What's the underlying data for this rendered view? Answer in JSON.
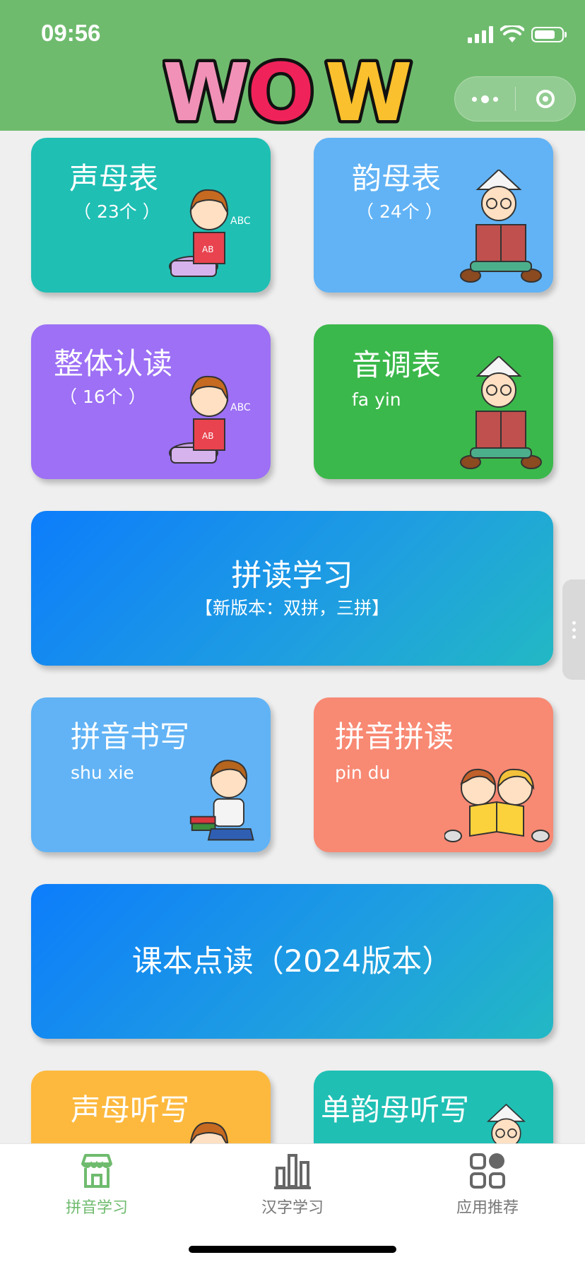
{
  "status_bar": {
    "time": "09:56"
  },
  "header": {
    "logo_text": "WOW"
  },
  "colors": {
    "header_bg": "#6fbb6e",
    "teal": "#1fbfb4",
    "light_blue": "#61b3f5",
    "purple": "#9d70f5",
    "green": "#3bb84b",
    "salmon": "#f88973",
    "orange": "#fdb93e",
    "tab_active": "#6fbb6e"
  },
  "cards": {
    "shengmu": {
      "title": "声母表",
      "sub": "（ 23个 ）"
    },
    "yunmu": {
      "title": "韵母表",
      "sub": "（ 24个 ）"
    },
    "zhengti": {
      "title": "整体认读",
      "sub": "（ 16个 ）"
    },
    "yindiao": {
      "title": "音调表",
      "sub": "fa yin"
    },
    "pindu_study": {
      "title": "拼读学习",
      "sub": "【新版本：双拼，三拼】"
    },
    "shuxie": {
      "title": "拼音书写",
      "sub": "shu xie"
    },
    "pinyin_pindu": {
      "title": "拼音拼读",
      "sub": "pin du"
    },
    "textbook": {
      "title": "课本点读（2024版本）"
    },
    "shengmu_tingxie": {
      "title": "声母听写"
    },
    "danyunmu_tingxie": {
      "title": "单韵母听写"
    }
  },
  "tabbar": {
    "tabs": [
      {
        "label": "拼音学习",
        "icon": "store-icon",
        "active": true
      },
      {
        "label": "汉字学习",
        "icon": "bar-chart-icon",
        "active": false
      },
      {
        "label": "应用推荐",
        "icon": "grid-apps-icon",
        "active": false
      }
    ]
  }
}
